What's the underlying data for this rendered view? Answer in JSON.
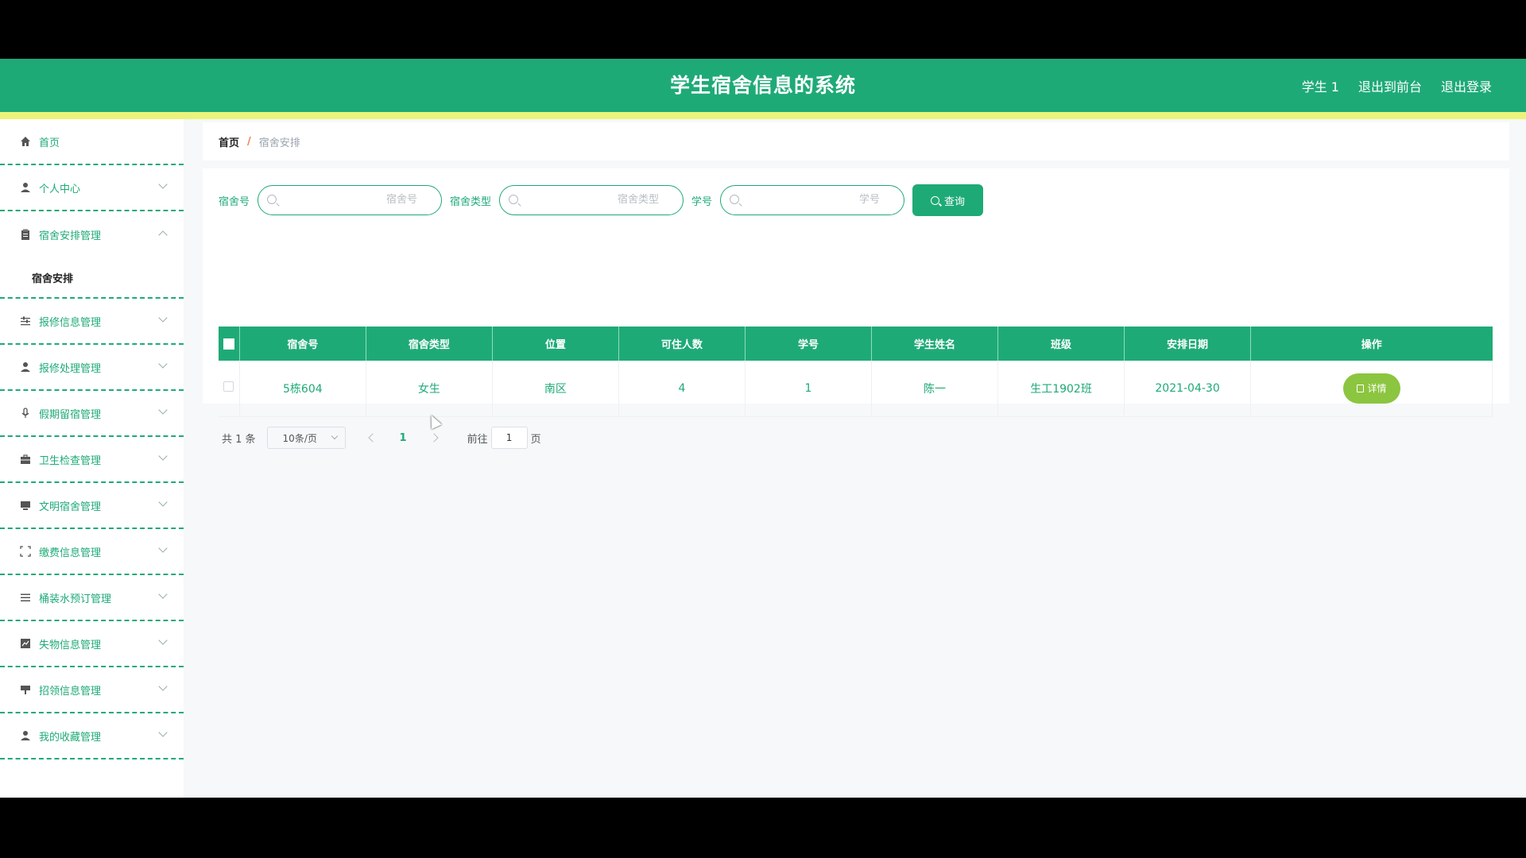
{
  "header": {
    "title": "学生宿舍信息的系统",
    "user": "学生 1",
    "to_front": "退出到前台",
    "logout": "退出登录"
  },
  "sidebar": {
    "items": [
      {
        "label": "首页",
        "icon": "home-icon"
      },
      {
        "label": "个人中心",
        "icon": "user-icon"
      },
      {
        "label": "宿舍安排管理",
        "icon": "clipboard-icon"
      },
      {
        "label": "报修信息管理",
        "icon": "sliders-icon"
      },
      {
        "label": "报修处理管理",
        "icon": "user-icon"
      },
      {
        "label": "假期留宿管理",
        "icon": "microphone-icon"
      },
      {
        "label": "卫生检查管理",
        "icon": "briefcase-icon"
      },
      {
        "label": "文明宿舍管理",
        "icon": "monitor-icon"
      },
      {
        "label": "缴费信息管理",
        "icon": "scan-icon"
      },
      {
        "label": "桶装水预订管理",
        "icon": "menu-icon"
      },
      {
        "label": "失物信息管理",
        "icon": "chart-icon"
      },
      {
        "label": "招领信息管理",
        "icon": "signpost-icon"
      },
      {
        "label": "我的收藏管理",
        "icon": "user-icon"
      }
    ],
    "submenu_active": "宿舍安排"
  },
  "breadcrumb": {
    "home": "首页",
    "separator": "/",
    "current": "宿舍安排"
  },
  "search": {
    "dorm_label": "宿舍号",
    "dorm_placeholder": "宿舍号",
    "type_label": "宿舍类型",
    "type_placeholder": "宿舍类型",
    "student_label": "学号",
    "student_placeholder": "学号",
    "query_button": "查询"
  },
  "table": {
    "columns": [
      "宿舍号",
      "宿舍类型",
      "位置",
      "可住人数",
      "学号",
      "学生姓名",
      "班级",
      "安排日期",
      "操作"
    ],
    "rows": [
      {
        "dorm": "5栋604",
        "type": "女生",
        "location": "南区",
        "capacity": "4",
        "student_id": "1",
        "name": "陈一",
        "class": "生工1902班",
        "date": "2021-04-30",
        "action": "详情"
      }
    ]
  },
  "pagination": {
    "total": "共 1 条",
    "page_size": "10条/页",
    "current_page": "1",
    "goto_label": "前往",
    "goto_value": "1",
    "page_suffix": "页"
  },
  "colors": {
    "primary": "#1eaa77",
    "stripe": "#ecf37a",
    "detail_button": "#8cc53f"
  }
}
